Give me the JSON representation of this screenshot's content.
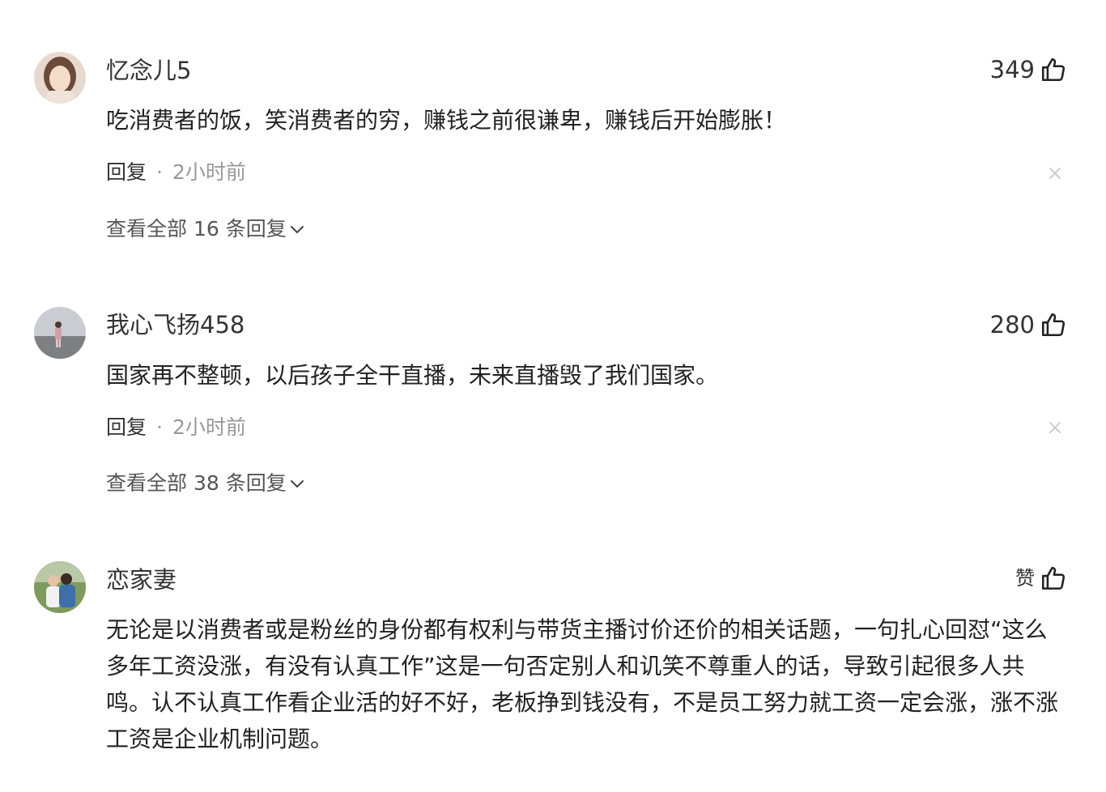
{
  "comments": [
    {
      "username": "忆念儿5",
      "likes": "349",
      "text": "吃消费者的饭，笑消费者的穷，赚钱之前很谦卑，赚钱后开始膨胀！",
      "reply_label": "回复",
      "separator": "·",
      "time": "2小时前",
      "view_replies": "查看全部 16 条回复"
    },
    {
      "username": "我心飞扬458",
      "likes": "280",
      "text": "国家再不整顿，以后孩子全干直播，未来直播毁了我们国家。",
      "reply_label": "回复",
      "separator": "·",
      "time": "2小时前",
      "view_replies": "查看全部 38 条回复"
    },
    {
      "username": "恋家妻",
      "likes": "赞",
      "text": "无论是以消费者或是粉丝的身份都有权利与带货主播讨价还价的相关话题，一句扎心回怼“这么多年工资没涨，有没有认真工作”这是一句否定别人和讥笑不尊重人的话，导致引起很多人共鸣。认不认真工作看企业活的好不好，老板挣到钱没有，不是员工努力就工资一定会涨，涨不涨工资是企业机制问题。"
    }
  ],
  "icons": {
    "like": "thumbs-up-icon",
    "close": "close-icon",
    "expand": "chevron-down-icon"
  },
  "colors": {
    "primary_text": "#222222",
    "secondary_text": "#999999",
    "background": "#ffffff"
  }
}
